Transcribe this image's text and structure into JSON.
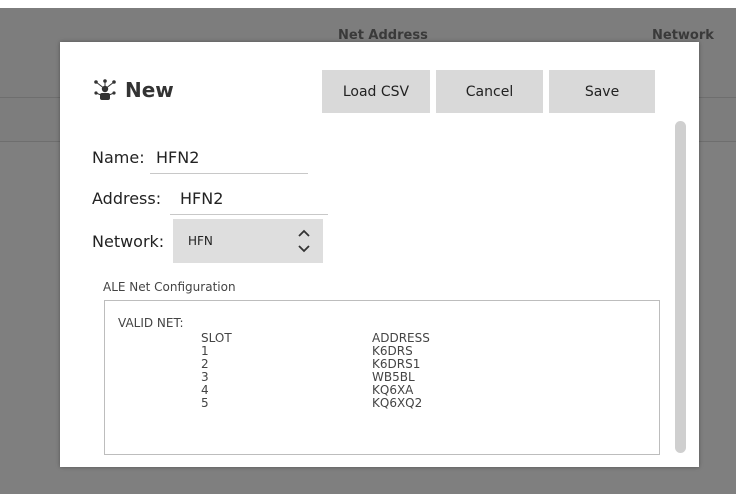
{
  "background": {
    "header_columns": [
      "Net Address",
      "Network"
    ]
  },
  "dialog": {
    "title": "New",
    "title_icon": "network-nodes-icon",
    "buttons": {
      "load_csv": "Load CSV",
      "cancel": "Cancel",
      "save": "Save"
    },
    "fields": {
      "name_label": "Name:",
      "name_value": "HFN2",
      "address_label": "Address:",
      "address_value": "HFN2",
      "network_label": "Network:",
      "network_value": "HFN"
    },
    "config": {
      "label": "ALE Net Configuration",
      "heading": "VALID NET:",
      "slot_header": "SLOT",
      "address_header": "ADDRESS",
      "rows": [
        {
          "slot": "1",
          "address": "K6DRS"
        },
        {
          "slot": "2",
          "address": "K6DRS1"
        },
        {
          "slot": "3",
          "address": "WB5BL"
        },
        {
          "slot": "4",
          "address": "KQ6XA"
        },
        {
          "slot": "5",
          "address": "KQ6XQ2"
        }
      ]
    }
  }
}
